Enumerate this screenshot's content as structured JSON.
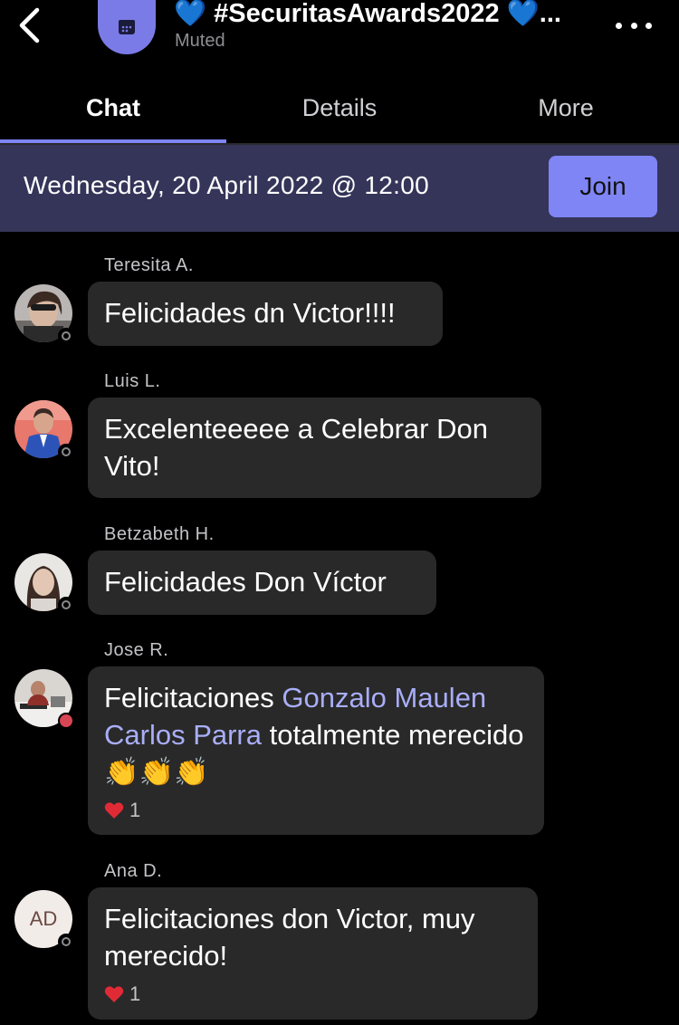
{
  "header": {
    "title": "💙 #SecuritasAwards2022 💙...",
    "subtitle": "Muted"
  },
  "tabs": [
    {
      "label": "Chat",
      "active": true
    },
    {
      "label": "Details",
      "active": false
    },
    {
      "label": "More",
      "active": false
    }
  ],
  "banner": {
    "datetime": "Wednesday, 20 April 2022 @ 12:00",
    "join_label": "Join"
  },
  "messages": [
    {
      "sender": "Teresita A.",
      "text": "Felicidades dn Victor!!!!",
      "status": "offline"
    },
    {
      "sender": "Luis L.",
      "text": "Excelenteeeee a Celebrar Don Vito!",
      "status": "offline"
    },
    {
      "sender": "Betzabeth H.",
      "text": "Felicidades Don Víctor",
      "status": "offline"
    },
    {
      "sender": "Jose R.",
      "text_before": "Felicitaciones ",
      "mention": "Gonzalo Maulen Carlos Parra",
      "text_after": " totalmente merecido 👏👏👏",
      "status": "busy",
      "reaction_count": "1"
    },
    {
      "sender": "Ana D.",
      "initials": "AD",
      "text": "Felicitaciones don Victor, muy merecido!",
      "status": "offline",
      "reaction_count": "1"
    }
  ],
  "colors": {
    "accent": "#7f85f5",
    "banner": "#35355a",
    "bubble": "#292929",
    "mention": "#a9aef8",
    "busy": "#d74654"
  },
  "icons": [
    "chevron-left-icon",
    "calendar-icon",
    "more-icon",
    "heart-icon"
  ]
}
